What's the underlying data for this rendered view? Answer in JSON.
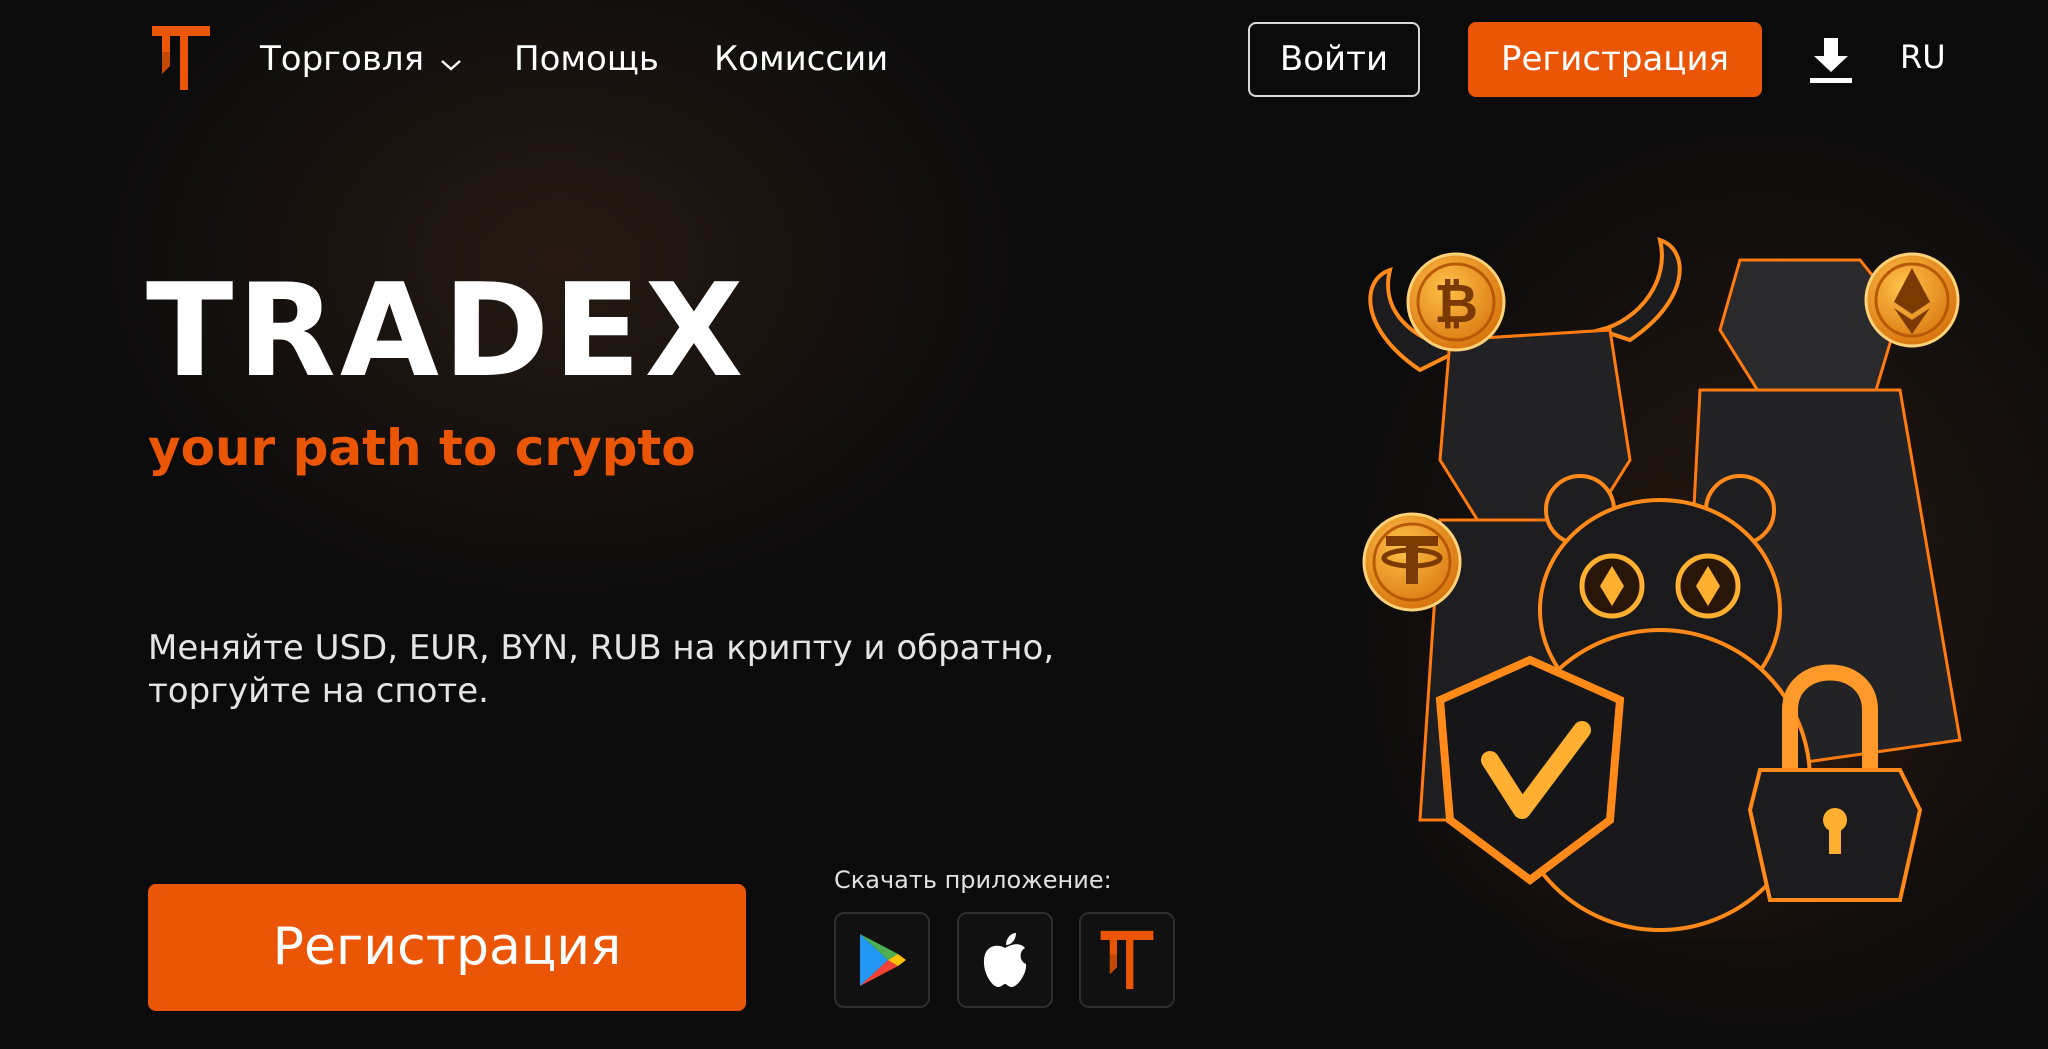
{
  "brand": {
    "name": "TRADEX",
    "tagline": "your path to crypto",
    "accent_color": "#ea5606",
    "logo_icon": "tradex-logo-icon"
  },
  "nav": {
    "items": [
      {
        "label": "Торговля",
        "has_dropdown": true
      },
      {
        "label": "Помощь"
      },
      {
        "label": "Комиссии"
      }
    ],
    "login_label": "Войти",
    "register_label": "Регистрация",
    "download_icon": "download-icon",
    "language": "RU"
  },
  "hero": {
    "description_line1": "Меняйте USD, EUR, BYN, RUB на крипту и обратно,",
    "description_line2": "торгуйте на споте.",
    "register_label": "Регистрация",
    "apps_label": "Скачать приложение:",
    "apps": [
      {
        "icon": "google-play-icon"
      },
      {
        "icon": "apple-icon"
      },
      {
        "icon": "tradex-app-icon"
      }
    ]
  },
  "illustration": {
    "coins": [
      "bitcoin-coin-icon",
      "ethereum-coin-icon",
      "tether-coin-icon"
    ],
    "characters": [
      "bull",
      "bear",
      "hamster",
      "shield",
      "padlock"
    ]
  }
}
